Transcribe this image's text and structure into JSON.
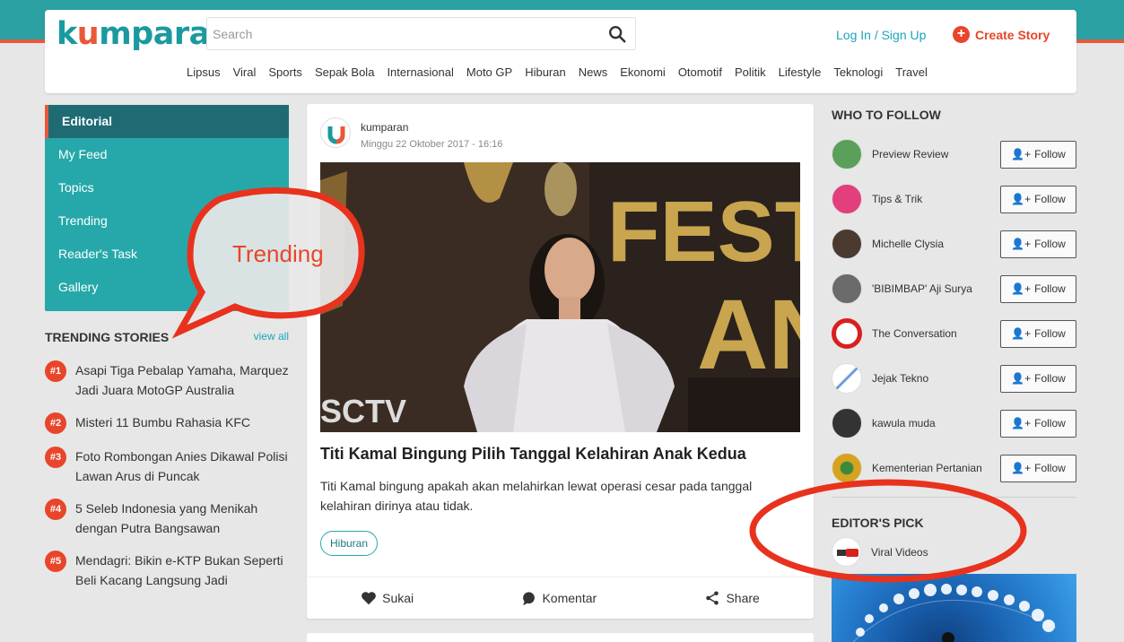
{
  "header": {
    "logo": {
      "pre": "k",
      "u": "u",
      "post": "mparan"
    },
    "search_placeholder": "Search",
    "login_label": "Log In / Sign Up",
    "create_story_label": "Create Story",
    "nav": [
      "Lipsus",
      "Viral",
      "Sports",
      "Sepak Bola",
      "Internasional",
      "Moto GP",
      "Hiburan",
      "News",
      "Ekonomi",
      "Otomotif",
      "Politik",
      "Lifestyle",
      "Teknologi",
      "Travel"
    ]
  },
  "sidebar": {
    "items": [
      {
        "label": "Editorial",
        "active": true
      },
      {
        "label": "My Feed"
      },
      {
        "label": "Topics"
      },
      {
        "label": "Trending"
      },
      {
        "label": "Reader's Task"
      },
      {
        "label": "Gallery"
      }
    ]
  },
  "trending": {
    "title": "TRENDING STORIES",
    "view_all": "view all",
    "items": [
      {
        "rank": "#1",
        "text": "Asapi Tiga Pebalap Yamaha, Marquez Jadi Juara MotoGP Australia"
      },
      {
        "rank": "#2",
        "text": "Misteri 11 Bumbu Rahasia KFC"
      },
      {
        "rank": "#3",
        "text": "Foto Rombongan Anies Dikawal Polisi Lawan Arus di Puncak"
      },
      {
        "rank": "#4",
        "text": "5 Seleb Indonesia yang Menikah dengan Putra Bangsawan"
      },
      {
        "rank": "#5",
        "text": "Mendagri: Bikin e-KTP Bukan Seperti Beli Kacang Langsung Jadi"
      }
    ]
  },
  "post": {
    "author": "kumparan",
    "date": "Minggu 22 Oktober 2017 - 16:16",
    "title": "Titi Kamal Bingung Pilih Tanggal Kelahiran Anak Kedua",
    "excerpt": "Titi Kamal bingung apakah akan melahirkan lewat operasi cesar pada tanggal kelahiran dirinya atau tidak.",
    "tag": "Hiburan",
    "image_text": {
      "fest": "FEST",
      "an": "AN",
      "sctv": "SCTV"
    },
    "actions": {
      "like": "Sukai",
      "comment": "Komentar",
      "share": "Share"
    }
  },
  "who_to_follow": {
    "title": "WHO TO FOLLOW",
    "follow_label": "Follow",
    "items": [
      {
        "name": "Preview Review",
        "color": "#4a9a4e"
      },
      {
        "name": "Tips & Trik",
        "color": "#e23f7c"
      },
      {
        "name": "Michelle Clysia",
        "color": "#4a3a30"
      },
      {
        "name": "'BIBIMBAP' Aji Surya",
        "color": "#6b6b6b"
      },
      {
        "name": "The Conversation",
        "color": "#d8201f"
      },
      {
        "name": "Jejak Tekno",
        "color": "#3a7fd0"
      },
      {
        "name": "kawula muda",
        "color": "#333333"
      },
      {
        "name": "Kementerian Pertanian",
        "color": "#d7a21e"
      }
    ]
  },
  "editors_pick": {
    "title": "EDITOR'S PICK",
    "items": [
      {
        "name": "Viral Videos"
      }
    ]
  },
  "annotations": {
    "bubble_text": "Trending",
    "color": "#e8452b"
  }
}
